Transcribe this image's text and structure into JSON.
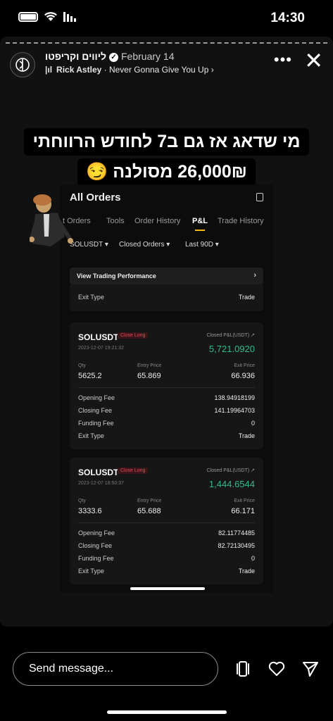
{
  "status_bar": {
    "time": "14:30"
  },
  "story": {
    "username": "ליווים וקריפטו",
    "date": "February 14",
    "music_artist": "Rick Astley",
    "music_title": " · Never Gonna Give You Up ›",
    "caption_line1": "מי שדאג אז גם ב7 לחודש הרווחתי",
    "caption_line2": "26,000₪ מסולנה 😏"
  },
  "screenshot": {
    "title": "All Orders",
    "tabs": [
      "t Orders",
      "Tools",
      "Order History",
      "P&L",
      "Trade History"
    ],
    "active_tab": "P&L",
    "filters": [
      "SOLUSDT ▾",
      "Closed Orders ▾",
      "Last 90D ▾"
    ],
    "view_trading_performance": "View Trading Performance",
    "exit_type_label": "Exit Type",
    "exit_type_value": "Trade",
    "orders": [
      {
        "pair": "SOLUSDT",
        "badge": "Close Long",
        "timestamp": "2023-12-07 19:21:32",
        "pnl_label": "Closed P&L(USDT)",
        "pnl": "5,721.0920",
        "qty_label": "Qty",
        "qty": "5625.2",
        "entry_label": "Entry Price",
        "entry": "65.869",
        "exit_label": "Exit Price",
        "exit": "66.936",
        "fees": [
          {
            "label": "Opening Fee",
            "value": "138.94918199"
          },
          {
            "label": "Closing Fee",
            "value": "141.19964703"
          },
          {
            "label": "Funding Fee",
            "value": "0"
          },
          {
            "label": "Exit Type",
            "value": "Trade"
          }
        ]
      },
      {
        "pair": "SOLUSDT",
        "badge": "Close Long",
        "timestamp": "2023-12-07 18:50:37",
        "pnl_label": "Closed P&L(USDT)",
        "pnl": "1,444.6544",
        "qty_label": "Qty",
        "qty": "3333.6",
        "entry_label": "Entry Price",
        "entry": "65.688",
        "exit_label": "Exit Price",
        "exit": "66.171",
        "fees": [
          {
            "label": "Opening Fee",
            "value": "82.11774485"
          },
          {
            "label": "Closing Fee",
            "value": "82.72130495"
          },
          {
            "label": "Funding Fee",
            "value": "0"
          },
          {
            "label": "Exit Type",
            "value": "Trade"
          }
        ]
      }
    ]
  },
  "reply_bar": {
    "placeholder": "Send message..."
  },
  "icons": [
    "battery-icon",
    "wifi-icon",
    "signal-icon",
    "more-icon",
    "close-icon",
    "gallery-icon",
    "heart-icon",
    "send-icon"
  ],
  "colors": {
    "profit_green": "#2ebd85",
    "close_long_red": "#e04a59",
    "tab_accent": "#f0b90b"
  }
}
